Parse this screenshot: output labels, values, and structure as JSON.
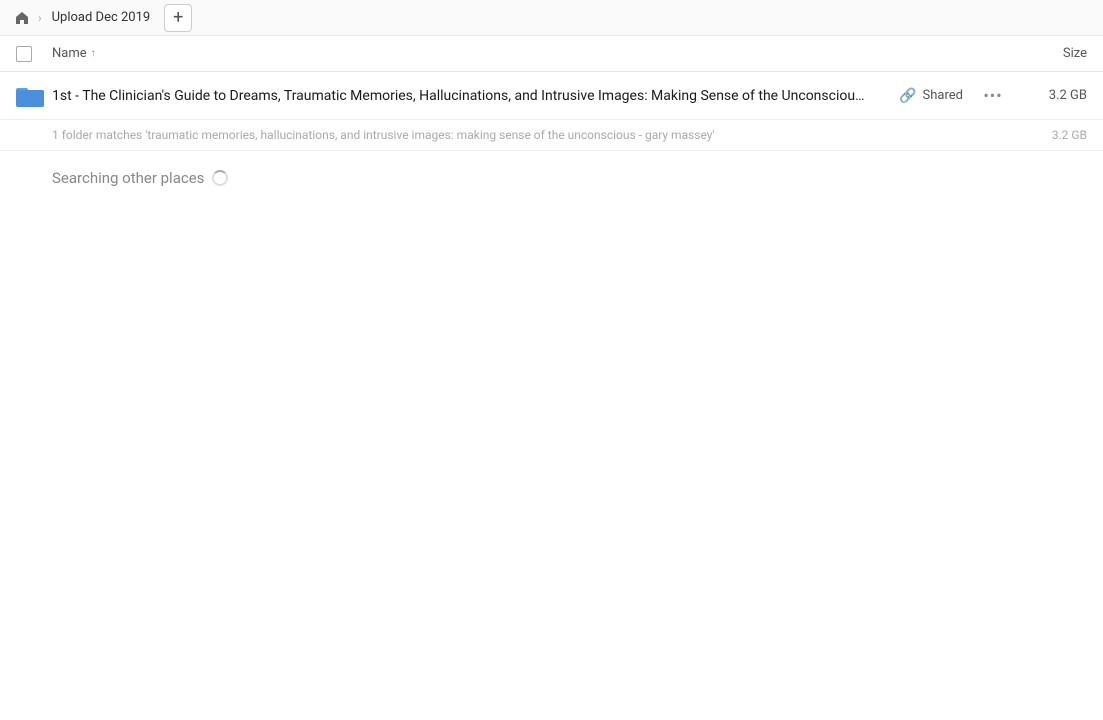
{
  "topbar": {
    "home_icon": "home",
    "breadcrumb_label": "Upload Dec 2019",
    "add_button_label": "+"
  },
  "header": {
    "name_label": "Name",
    "sort_direction": "↑",
    "size_label": "Size"
  },
  "file_row": {
    "name": "1st - The Clinician's Guide to Dreams, Traumatic Memories, Hallucinations, and Intrusive Images: Making Sense of the Unconscious ...",
    "shared_label": "Shared",
    "size": "3.2 GB",
    "more_icon": "•••"
  },
  "sub_info": {
    "text": "1 folder matches 'traumatic memories, hallucinations, and intrusive images: making sense of the unconscious - gary massey'",
    "size": "3.2 GB"
  },
  "searching": {
    "label": "Searching other places"
  }
}
